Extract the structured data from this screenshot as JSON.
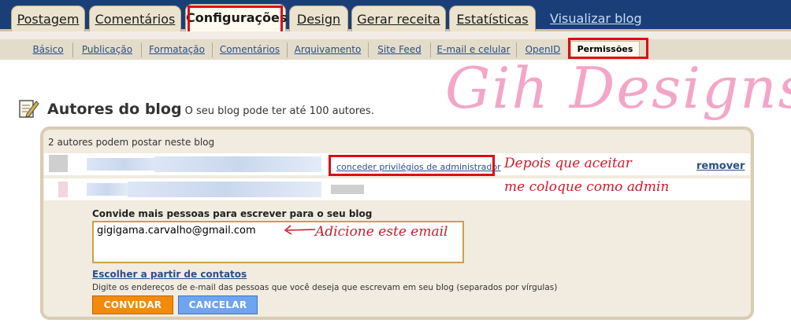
{
  "main_tabs": [
    {
      "label": "Postagem"
    },
    {
      "label": "Comentários"
    },
    {
      "label": "Configurações",
      "active": true
    },
    {
      "label": "Design"
    },
    {
      "label": "Gerar receita"
    },
    {
      "label": "Estatísticas"
    }
  ],
  "view_blog_label": "Visualizar blog",
  "sub_tabs": [
    {
      "label": "Básico"
    },
    {
      "label": "Publicação"
    },
    {
      "label": "Formatação"
    },
    {
      "label": "Comentários"
    },
    {
      "label": "Arquivamento"
    },
    {
      "label": "Site Feed"
    },
    {
      "label": "E-mail e celular"
    },
    {
      "label": "OpenID"
    }
  ],
  "active_sub_tab": "Permissões",
  "watermark": "Gih Designs",
  "page": {
    "title": "Autores do blog",
    "subtitle": "O seu blog pode ter até 100 autores."
  },
  "authors": {
    "count_text": "2 autores podem postar neste blog",
    "grant_admin_label": "conceder privilégios de administrador",
    "remove_label": "remover"
  },
  "annotations": {
    "line1": "Depois que aceitar",
    "line2": "me coloque como admin",
    "email_note": "Adicione este email"
  },
  "invite": {
    "label": "Convide mais pessoas para escrever para o seu blog",
    "email_value": "gigigama.carvalho@gmail.com",
    "contacts_link": "Escolher a partir de contatos",
    "hint": "Digite os endereços de e-mail das pessoas que você deseja que escrevam em seu blog (separados por vírgulas)",
    "invite_button": "CONVIDAR",
    "cancel_button": "CANCELAR"
  },
  "colors": {
    "nav_bg": "#1a3f78",
    "highlight_red": "#dd0a12",
    "link_blue": "#2a4f86",
    "invite_orange": "#f28b0c",
    "cancel_blue": "#6ea4f0",
    "annotation_red": "#cc1b2b",
    "watermark_pink": "#f3a6c8"
  }
}
